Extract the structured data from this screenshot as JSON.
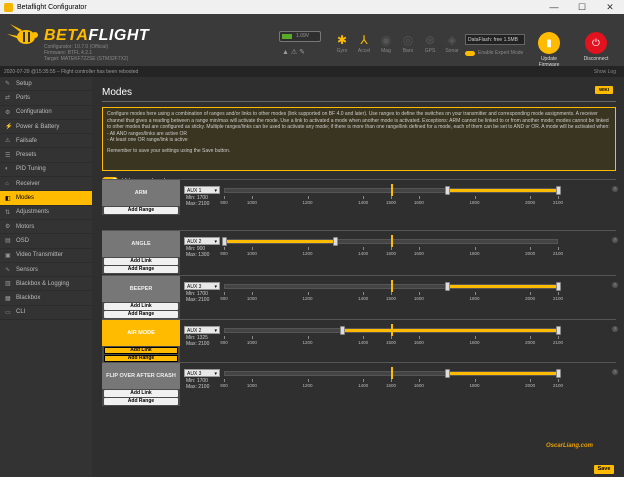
{
  "window": {
    "title": "Betaflight Configurator",
    "minimize": "—",
    "maximize": "☐",
    "close": "✕"
  },
  "header": {
    "brand_part1": "BETA",
    "brand_part2": "FLIGHT",
    "config_lines": [
      "Configurator: 10.7.0 (Official)",
      "Firmware: BTFL 4.2.1",
      "Target: MATEKF722SE (STM32F7X2)"
    ],
    "battery_text": "1.09V",
    "sensors": [
      {
        "label": "Gyro",
        "icon": "✱",
        "active": true
      },
      {
        "label": "Accel",
        "icon": "⅄",
        "active": true
      },
      {
        "label": "Mag",
        "icon": "◉",
        "active": false
      },
      {
        "label": "Baro",
        "icon": "◎",
        "active": false
      },
      {
        "label": "GPS",
        "icon": "⊛",
        "active": false
      },
      {
        "label": "Sonar",
        "icon": "◈",
        "active": false
      }
    ],
    "port_value": "DataFlash: free 1.5MB",
    "expert_mode": "Enable Expert Mode",
    "update_firmware": "Update Firmware",
    "disconnect": "Disconnect"
  },
  "logbar": {
    "text": "2020-07-29 @15:35:55 – Flight controller has been rebooted",
    "show_log": "Show Log"
  },
  "sidebar": {
    "items": [
      {
        "label": "Setup",
        "icon": "✎"
      },
      {
        "label": "Ports",
        "icon": "⇄"
      },
      {
        "label": "Configuration",
        "icon": "⚙"
      },
      {
        "label": "Power & Battery",
        "icon": "⚡"
      },
      {
        "label": "Failsafe",
        "icon": "⚠"
      },
      {
        "label": "Presets",
        "icon": "☰"
      },
      {
        "label": "PID Tuning",
        "icon": "◐"
      },
      {
        "label": "Receiver",
        "icon": "⌂"
      },
      {
        "label": "Modes",
        "icon": "◧",
        "active": true
      },
      {
        "label": "Adjustments",
        "icon": "⇅"
      },
      {
        "label": "Motors",
        "icon": "⚙"
      },
      {
        "label": "OSD",
        "icon": "▤"
      },
      {
        "label": "Video Transmitter",
        "icon": "▣"
      },
      {
        "label": "Sensors",
        "icon": "∿"
      },
      {
        "label": "Blackbox & Logging",
        "icon": "▥"
      },
      {
        "label": "Blackbox",
        "icon": "▦"
      },
      {
        "label": "CLI",
        "icon": "▭"
      }
    ]
  },
  "main": {
    "title": "Modes",
    "wiki": "WIKI",
    "note": "Configure modes here using a combination of ranges and/or links to other modes (link supported on BF 4.0 and later). Use ranges to define the switches on your transmitter and corresponding mode assignments. A receiver channel that gives a reading between a range min/max will activate the mode. Use a link to activated a mode when another mode is activated. Exceptions: ARM cannot be linked to or from another mode; modes cannot be linked to other modes that are configured as sticky. Multiple ranges/links can be used to activate any mode; if there is more than one range/link defined for a mode, each of them can be set to AND or OR. A mode will be activated when:",
    "note_bullets": [
      "- All AND ranges/links are active OR",
      "- At least one OR range/link is active"
    ],
    "note_footer": "Remember to save your settings using the Save button.",
    "hide_unused": "Hide unused modes",
    "add_range": "Add Range",
    "add_link": "Add Link",
    "save": "Save",
    "watermark": "OscarLiang.com"
  },
  "tick_labels": [
    "900",
    "1000",
    "1200",
    "1400",
    "1500",
    "1600",
    "1800",
    "2000",
    "2100"
  ],
  "modes": [
    {
      "name": "ARM",
      "active": false,
      "aux": "AUX 1",
      "min": "Min: 1700",
      "max": "Max: 2100",
      "range": [
        1700,
        2100
      ],
      "channel": 1500,
      "has_link": false
    },
    {
      "name": "ANGLE",
      "active": false,
      "aux": "AUX 2",
      "min": "Min: 900",
      "max": "Max: 1300",
      "range": [
        900,
        1300
      ],
      "channel": 1500,
      "has_link": true
    },
    {
      "name": "BEEPER",
      "active": false,
      "aux": "AUX 3",
      "min": "Min: 1700",
      "max": "Max: 2100",
      "range": [
        1700,
        2100
      ],
      "channel": 1500,
      "has_link": true
    },
    {
      "name": "AIR MODE",
      "active": true,
      "aux": "AUX 2",
      "min": "Min: 1325",
      "max": "Max: 2100",
      "range": [
        1325,
        2100
      ],
      "channel": 1500,
      "has_link": true
    },
    {
      "name": "FLIP OVER AFTER CRASH",
      "active": false,
      "aux": "AUX 3",
      "min": "Min: 1700",
      "max": "Max: 2100",
      "range": [
        1700,
        2100
      ],
      "channel": 1500,
      "has_link": true
    }
  ]
}
